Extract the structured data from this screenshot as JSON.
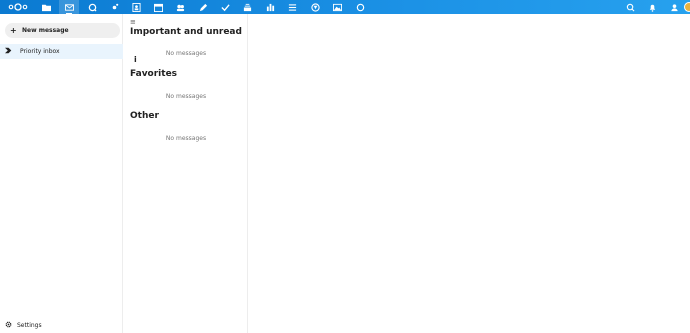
{
  "header": {
    "colors": {
      "gradient_start": "#0b7ad1",
      "gradient_end": "#27a1ee"
    },
    "apps": [
      {
        "name": "files-icon"
      },
      {
        "name": "mail-icon",
        "active": true
      },
      {
        "name": "search-app-icon"
      },
      {
        "name": "activity-icon"
      },
      {
        "name": "contacts-icon"
      },
      {
        "name": "calendar-icon"
      },
      {
        "name": "circles-icon"
      },
      {
        "name": "notes-icon"
      },
      {
        "name": "tasks-icon"
      },
      {
        "name": "deck-icon"
      },
      {
        "name": "analytics-icon"
      },
      {
        "name": "lists-icon"
      },
      {
        "name": "maps-icon"
      },
      {
        "name": "photos-icon"
      },
      {
        "name": "circle-app-icon"
      }
    ],
    "right_icons": [
      "search-icon",
      "notifications-icon",
      "contacts-menu-icon",
      "avatar"
    ]
  },
  "nav": {
    "new_message_label": "New message",
    "items": [
      {
        "label": "Priority inbox",
        "icon": "priority-inbox-icon",
        "active": true
      }
    ],
    "settings_label": "Settings"
  },
  "list": {
    "sections": [
      {
        "title": "Important and unread",
        "empty_text": "No messages"
      },
      {
        "title": "Favorites",
        "empty_text": "No messages"
      },
      {
        "title": "Other",
        "empty_text": "No messages"
      }
    ]
  }
}
